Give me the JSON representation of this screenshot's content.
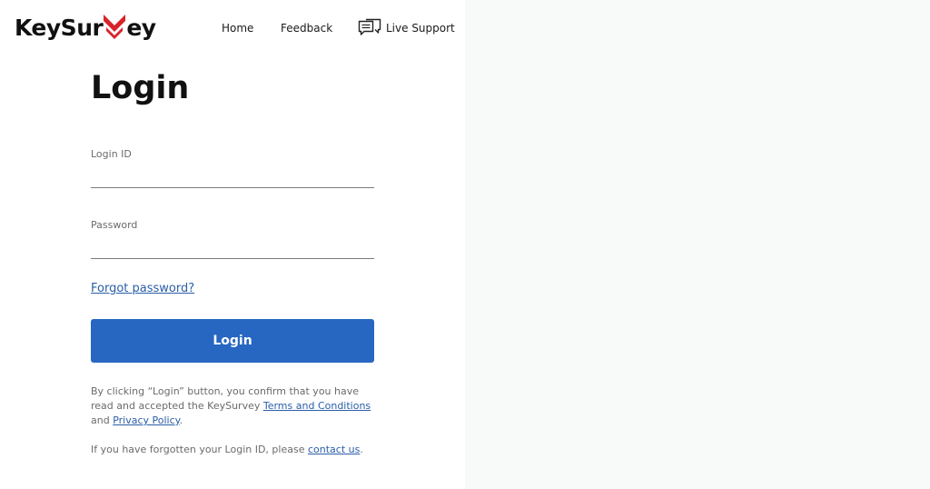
{
  "brand": {
    "name_part1": "KeySur",
    "name_part2": "ey",
    "accent": "#d8232a"
  },
  "nav": {
    "home": "Home",
    "feedback": "Feedback",
    "live_support": "Live Support"
  },
  "form": {
    "title": "Login",
    "login_id_label": "Login ID",
    "login_id_value": "",
    "password_label": "Password",
    "password_value": "",
    "forgot_password": "Forgot password?",
    "login_button": "Login",
    "button_color": "#2767c2"
  },
  "consent": {
    "text_before": "By clicking “Login” button, you confirm that you have read and accepted the KeySurvey ",
    "terms_link": "Terms and Conditions",
    "and": " and ",
    "privacy_link": "Privacy Policy",
    "period": "."
  },
  "forgot_id": {
    "text": "If you have forgotten your Login ID, please ",
    "contact_link": "contact us",
    "period": "."
  }
}
